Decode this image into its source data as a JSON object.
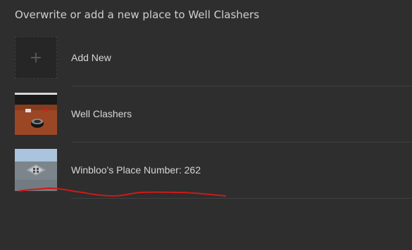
{
  "dialog": {
    "title": "Overwrite or add a new place to Well Clashers"
  },
  "items": [
    {
      "label": "Add New",
      "icon": "plus-icon"
    },
    {
      "label": "Well Clashers"
    },
    {
      "label": "Winbloo's Place Number: 262"
    }
  ],
  "colors": {
    "background": "#2e2e2e",
    "text": "#d6d6d6",
    "divider": "#404040",
    "annotation": "#cc1a1a"
  }
}
